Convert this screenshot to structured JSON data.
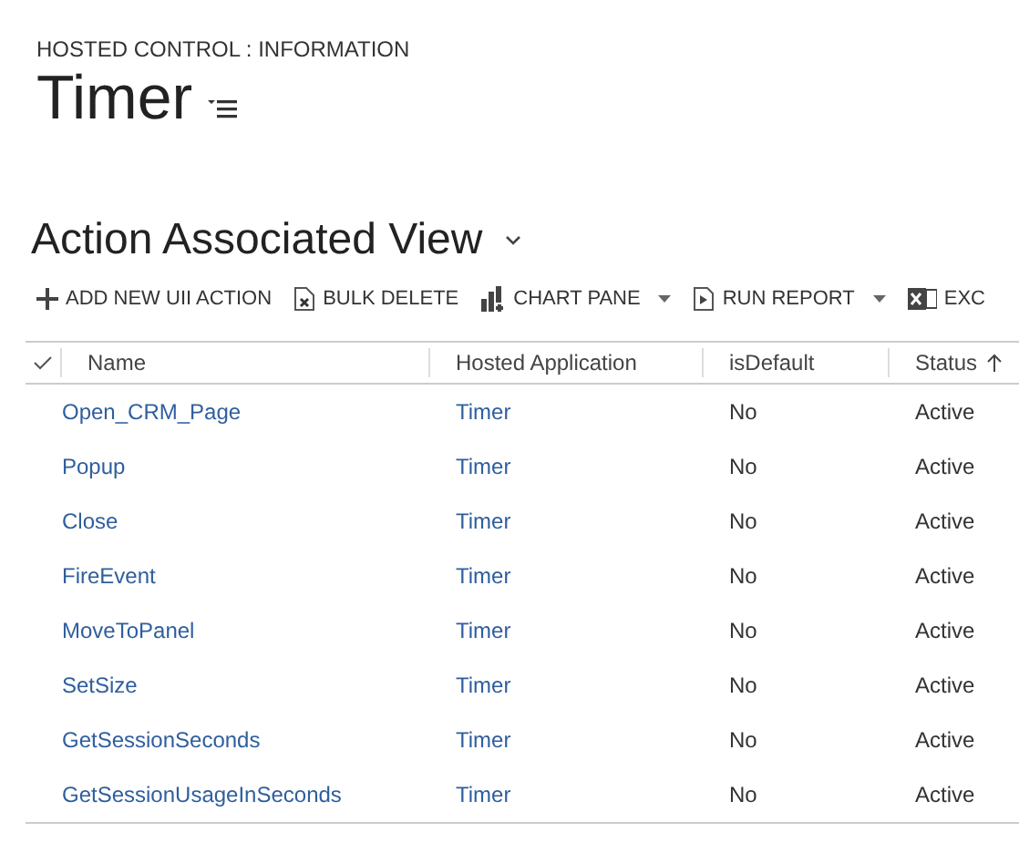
{
  "header": {
    "entity_label": "HOSTED CONTROL : INFORMATION",
    "title": "Timer"
  },
  "view": {
    "title": "Action Associated View"
  },
  "toolbar": [
    {
      "kind": "add",
      "label": "ADD NEW UII ACTION",
      "dropdown": false
    },
    {
      "kind": "delete",
      "label": "BULK DELETE",
      "dropdown": false
    },
    {
      "kind": "chart",
      "label": "CHART PANE",
      "dropdown": true
    },
    {
      "kind": "report",
      "label": "RUN REPORT",
      "dropdown": true
    },
    {
      "kind": "excel",
      "label": "EXC",
      "dropdown": false
    }
  ],
  "table": {
    "columns": [
      {
        "label": "Name",
        "sorted": false
      },
      {
        "label": "Hosted Application",
        "sorted": false
      },
      {
        "label": "isDefault",
        "sorted": false
      },
      {
        "label": "Status",
        "sorted": true
      }
    ],
    "rows": [
      {
        "name": "Open_CRM_Page",
        "hosted_application": "Timer",
        "is_default": "No",
        "status": "Active"
      },
      {
        "name": "Popup",
        "hosted_application": "Timer",
        "is_default": "No",
        "status": "Active"
      },
      {
        "name": "Close",
        "hosted_application": "Timer",
        "is_default": "No",
        "status": "Active"
      },
      {
        "name": "FireEvent",
        "hosted_application": "Timer",
        "is_default": "No",
        "status": "Active"
      },
      {
        "name": "MoveToPanel",
        "hosted_application": "Timer",
        "is_default": "No",
        "status": "Active"
      },
      {
        "name": "SetSize",
        "hosted_application": "Timer",
        "is_default": "No",
        "status": "Active"
      },
      {
        "name": "GetSessionSeconds",
        "hosted_application": "Timer",
        "is_default": "No",
        "status": "Active"
      },
      {
        "name": "GetSessionUsageInSeconds",
        "hosted_application": "Timer",
        "is_default": "No",
        "status": "Active"
      }
    ]
  }
}
